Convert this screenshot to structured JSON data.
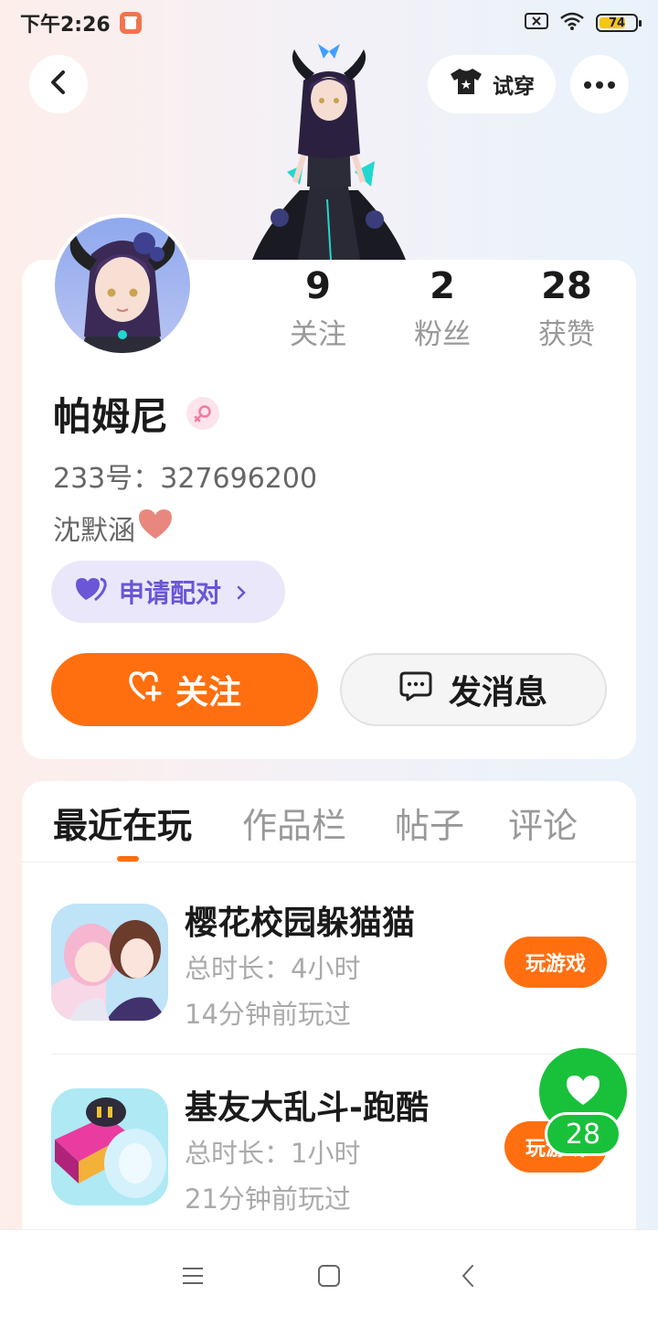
{
  "status_bar": {
    "time": "下午2:26",
    "battery": "74",
    "battery_level": 0.74,
    "icons": [
      "app-notification-icon",
      "sim-off-icon",
      "wifi-icon",
      "battery-icon"
    ]
  },
  "header": {
    "tryon_label": "试穿",
    "icons": [
      "back-arrow-icon",
      "tshirt-icon",
      "more-dots-icon"
    ]
  },
  "profile": {
    "name": "帕姆尼",
    "gender": "female-icon",
    "id_line": "233号：327696200",
    "bio_text": "沈默涵",
    "bio_emoji": "heart-icon",
    "pair_label": "申请配对",
    "stats": [
      {
        "value": "9",
        "label": "关注"
      },
      {
        "value": "2",
        "label": "粉丝"
      },
      {
        "value": "28",
        "label": "获赞"
      }
    ],
    "follow_label": "关注",
    "message_label": "发消息"
  },
  "tabs": [
    {
      "label": "最近在玩",
      "active": true
    },
    {
      "label": "作品栏",
      "active": false
    },
    {
      "label": "帖子",
      "active": false
    },
    {
      "label": "评论",
      "active": false
    }
  ],
  "games": [
    {
      "title": "樱花校园躲猫猫",
      "duration": "总时长：4小时",
      "last_played": "14分钟前玩过",
      "button": "玩游戏"
    },
    {
      "title": "基友大乱斗-跑酷",
      "duration": "总时长：1小时",
      "last_played": "21分钟前玩过",
      "button": "玩游戏"
    }
  ],
  "like_fab": {
    "count": "28"
  },
  "colors": {
    "accent_orange": "#ff6f0f",
    "pair_purple": "#6a56d6",
    "like_green": "#19c13a"
  }
}
